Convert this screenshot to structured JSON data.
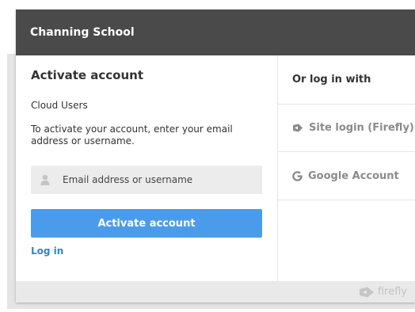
{
  "header": {
    "school_name": "Channing School"
  },
  "activate": {
    "title": "Activate account",
    "subtitle": "Cloud Users",
    "description": "To activate your account, enter your email address or username.",
    "input_placeholder": "Email address or username",
    "input_value": "",
    "button_label": "Activate account",
    "login_link": "Log in"
  },
  "alt_login": {
    "heading": "Or log in with",
    "options": [
      {
        "label": "Site login (Firefly)",
        "icon": "firefly-icon"
      },
      {
        "label": "Google Account",
        "icon": "google-g-icon"
      }
    ]
  },
  "footer": {
    "brand": "firefly",
    "icon": "firefly-logo-icon"
  },
  "colors": {
    "header_bg": "#4a4a4a",
    "primary_button": "#4a9cea",
    "link": "#2f85d8",
    "muted_text": "#8a8a8a"
  }
}
